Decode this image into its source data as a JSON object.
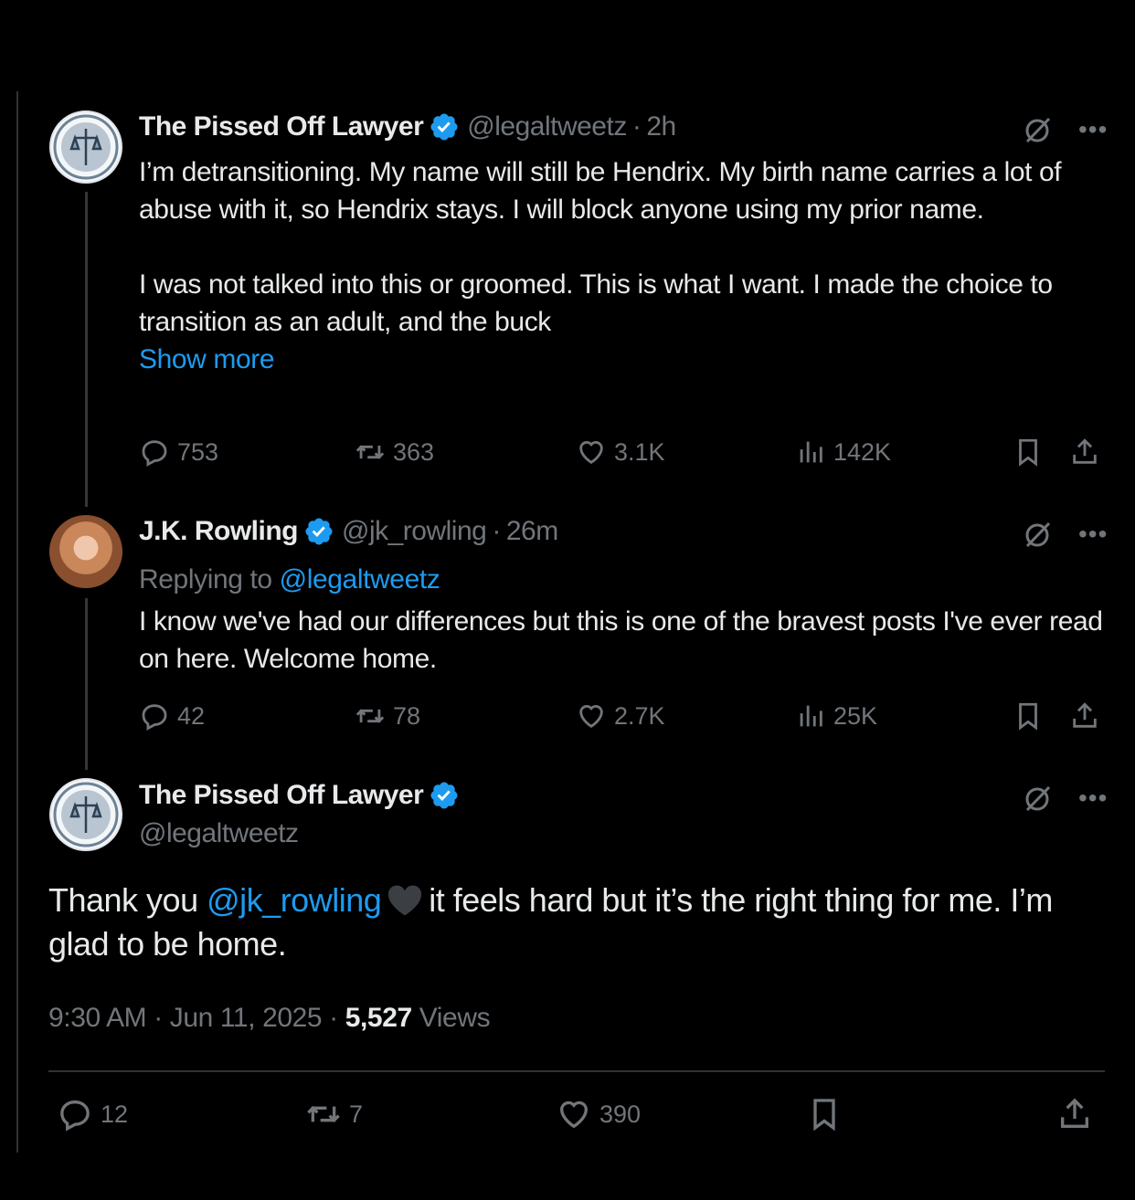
{
  "tweets": [
    {
      "name": "The Pissed Off Lawyer",
      "handle": "@legaltweetz",
      "time": "2h",
      "para1": "I’m detransitioning. My name will still be Hendrix. My birth name carries a lot of abuse with it, so Hendrix stays. I will block anyone using my prior name.",
      "para2": "I was not talked into this or groomed. This is what I want. I made the choice to transition as an adult, and the buck",
      "show_more": "Show more",
      "replies": "753",
      "reposts": "363",
      "likes": "3.1K",
      "views": "142K"
    },
    {
      "name": "J.K. Rowling",
      "handle": "@jk_rowling",
      "time": "26m",
      "replying_to_label": "Replying to",
      "replying_to_handle": "@legaltweetz",
      "text": "I know we've had our differences but this is one of the bravest posts I've ever read on here. Welcome home.",
      "replies": "42",
      "reposts": "78",
      "likes": "2.7K",
      "views": "25K"
    }
  ],
  "main_tweet": {
    "name": "The Pissed Off Lawyer",
    "handle": "@legaltweetz",
    "text_before": "Thank you",
    "mention": "@jk_rowling",
    "emoji": "black-heart",
    "text_after": "it feels hard but it’s the right thing for me. I’m glad to be home.",
    "time": "9:30 AM",
    "date": "Jun 11, 2025",
    "views_count": "5,527",
    "views_label": "Views",
    "replies": "12",
    "reposts": "7",
    "likes": "390"
  },
  "dot": "·",
  "colors": {
    "background": "#000000",
    "text": "#e7e9ea",
    "muted": "#71767b",
    "link": "#1d9bf0",
    "verified": "#1d9bf0"
  }
}
